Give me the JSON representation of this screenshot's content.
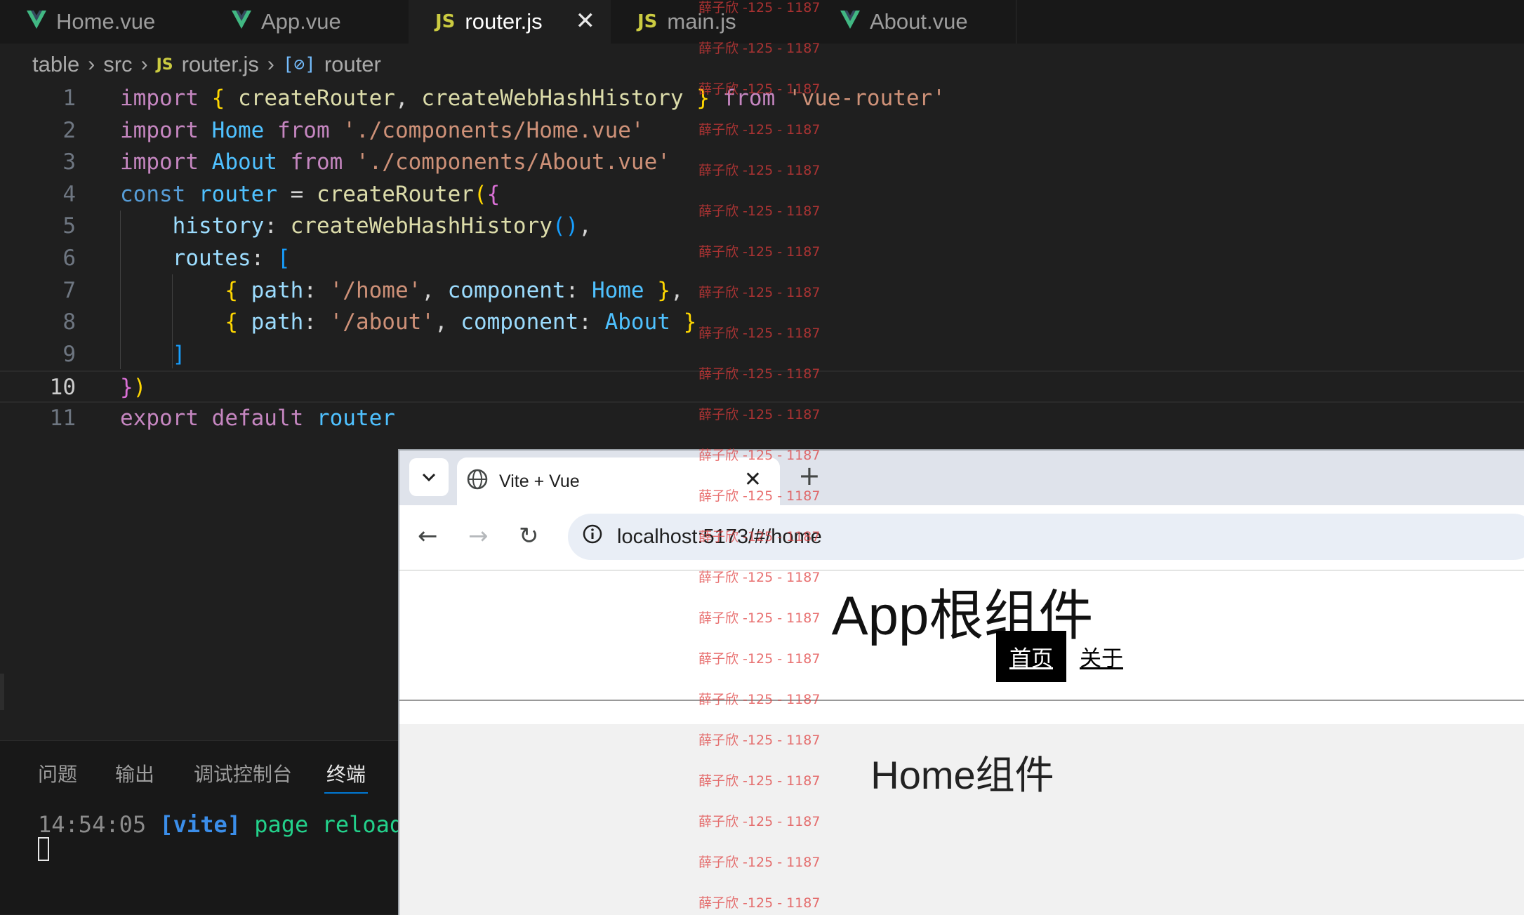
{
  "editor": {
    "tabs": [
      {
        "label": "Home.vue",
        "icon": "vue-icon",
        "active": false
      },
      {
        "label": "App.vue",
        "icon": "vue-icon",
        "active": false
      },
      {
        "label": "router.js",
        "icon": "js-icon",
        "active": true
      },
      {
        "label": "main.js",
        "icon": "js-icon",
        "active": false
      },
      {
        "label": "About.vue",
        "icon": "vue-icon",
        "active": false
      }
    ],
    "close_glyph": "✕",
    "js_badge": "JS",
    "breadcrumb": {
      "root": "table",
      "folder": "src",
      "file_icon": "JS",
      "file": "router.js",
      "symbol_icon": "[⊘]",
      "symbol": "router",
      "separator": "›"
    },
    "current_line": 10,
    "line_numbers": [
      "1",
      "2",
      "3",
      "4",
      "5",
      "6",
      "7",
      "8",
      "9",
      "10",
      "11"
    ]
  },
  "code_lines": [
    "import { createRouter, createWebHashHistory } from 'vue-router'",
    "import Home from './components/Home.vue'",
    "import About from './components/About.vue'",
    "const router = createRouter({",
    "    history: createWebHashHistory(),",
    "    routes: [",
    "        { path: '/home', component: Home },",
    "        { path: '/about', component: About }",
    "    ]",
    "})",
    "export default router"
  ],
  "panel": {
    "tabs": [
      "问题",
      "输出",
      "调试控制台",
      "终端"
    ],
    "active_tab": "终端",
    "terminal": {
      "time": "14:54:05",
      "tag": "[vite]",
      "message": "page reload s"
    }
  },
  "browser": {
    "tab_title": "Vite + Vue",
    "tab_close": "✕",
    "new_tab": "+",
    "url": "localhost:5173/#/home",
    "nav": {
      "back": "←",
      "forward": "→",
      "reload": "↻"
    },
    "page": {
      "app_title": "App根组件",
      "links": [
        {
          "label": "首页",
          "active": true
        },
        {
          "label": "关于",
          "active": false
        }
      ],
      "home_text": "Home组件"
    }
  },
  "watermark": {
    "text": "薛子欣 -125 - 1187",
    "color": "#e03b3b"
  },
  "colors": {
    "editor_bg": "#1f1f1f",
    "accent": "#0078d4",
    "keyword": "#c586c0",
    "string": "#ce9178"
  }
}
